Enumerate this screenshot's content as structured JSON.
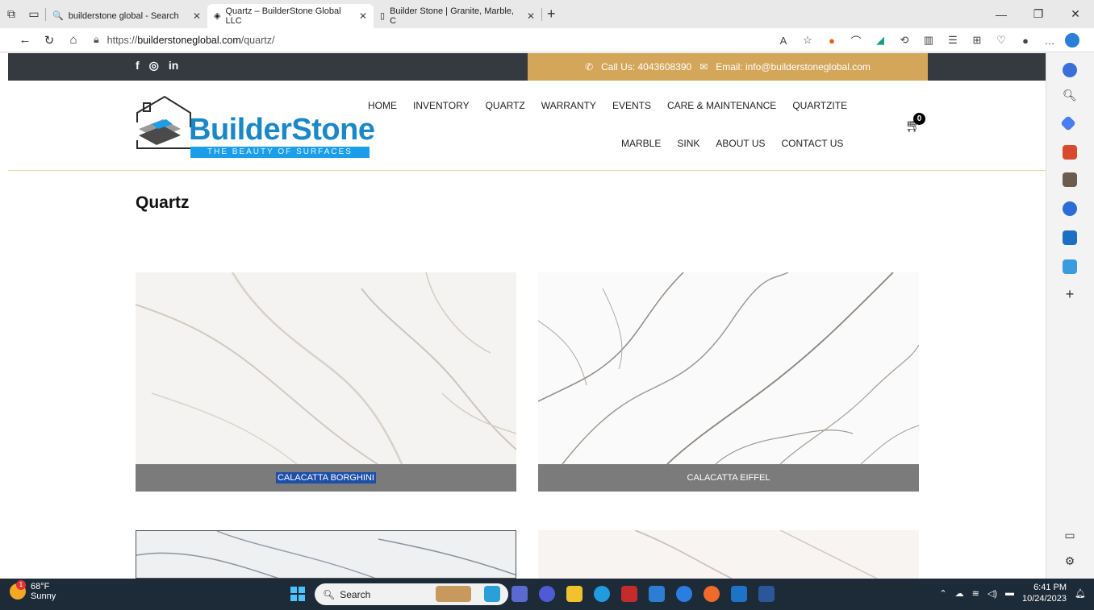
{
  "browser": {
    "tabs": [
      {
        "label": "builderstone global - Search",
        "active": false
      },
      {
        "label": "Quartz – BuilderStone Global LLC",
        "active": true
      },
      {
        "label": "Builder Stone | Granite, Marble, C",
        "active": false
      }
    ],
    "url_prefix": "https://",
    "url_domain": "builderstoneglobal.com",
    "url_path": "/quartz/"
  },
  "site": {
    "topbar": {
      "call": "Call Us: 4043608390",
      "email": "Email: info@builderstoneglobal.com",
      "social": [
        "f",
        "◎",
        "in"
      ]
    },
    "logo": {
      "name": "BuilderStone",
      "tagline": "THE BEAUTY OF SURFACES"
    },
    "nav_row1": [
      "HOME",
      "INVENTORY",
      "QUARTZ",
      "WARRANTY",
      "EVENTS",
      "CARE & MAINTENANCE",
      "QUARTZITE"
    ],
    "nav_row2": [
      "MARBLE",
      "SINK",
      "ABOUT US",
      "CONTACT US"
    ],
    "cart_count": "0",
    "page_title": "Quartz",
    "products": [
      {
        "name": "CALACATTA BORGHINI"
      },
      {
        "name": "CALACATTA EIFFEL"
      }
    ]
  },
  "taskbar": {
    "weather_temp": "68°F",
    "weather_desc": "Sunny",
    "weather_badge": "1",
    "search_label": "Search",
    "time": "6:41 PM",
    "date": "10/24/2023"
  },
  "colors": {
    "topbar": "#343a40",
    "accent_gold": "#d4a65a",
    "logo_blue": "#1a87c7",
    "caption_gray": "#7b7b7b",
    "selection_blue": "#1d4fa8"
  }
}
